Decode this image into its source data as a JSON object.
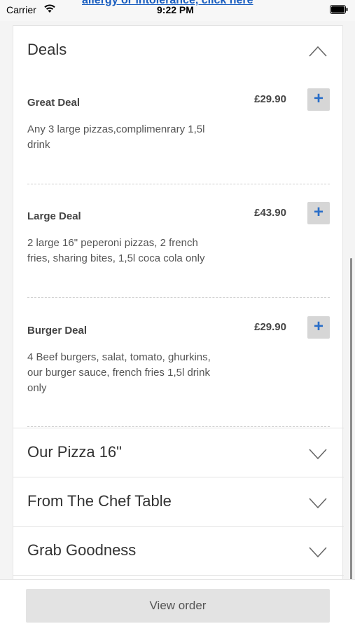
{
  "status_bar": {
    "carrier": "Carrier",
    "time": "9:22 PM",
    "wifi_icon": "wifi-icon",
    "battery_icon": "battery-icon"
  },
  "allergy_link": "allergy or intolerance, click here",
  "sections": {
    "deals": {
      "title": "Deals",
      "icon": "chevron-up-icon",
      "expanded": true
    },
    "pizza": {
      "title": "Our Pizza 16\"",
      "icon": "chevron-down-icon"
    },
    "chef": {
      "title": "From The Chef Table",
      "icon": "chevron-down-icon"
    },
    "grab": {
      "title": "Grab Goodness",
      "icon": "chevron-down-icon"
    }
  },
  "deals": [
    {
      "name": "Great Deal",
      "price": "£29.90",
      "desc_lines": [
        "Any 3 large pizzas,complimenrary 1,5l",
        "drink"
      ],
      "add_label": "+"
    },
    {
      "name": "Large Deal",
      "price": "£43.90",
      "desc_lines": [
        "2 large 16\" peperoni pizzas, 2 french",
        "fries, sharing bites, 1,5l coca cola only"
      ],
      "add_label": "+"
    },
    {
      "name": "Burger Deal",
      "price": "£29.90",
      "desc_lines": [
        "4 Beef burgers, salat, tomato, ghurkins,",
        "our burger sauce, french fries 1,5l drink",
        "only"
      ],
      "add_label": "+"
    }
  ],
  "bottom": {
    "view_order_label": "View order"
  },
  "colors": {
    "accent": "#2a6ec8",
    "link": "#1a5ec0",
    "button_bg": "#d6d6d6"
  }
}
